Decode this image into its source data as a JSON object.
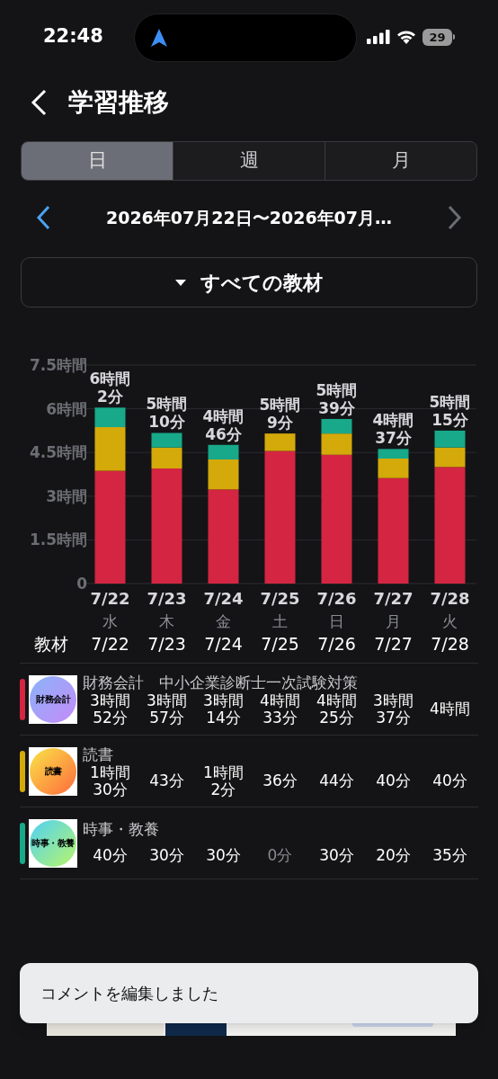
{
  "status_bar": {
    "time": "22:48",
    "battery": "29"
  },
  "header": {
    "title": "学習推移"
  },
  "tabs": [
    {
      "label": "日",
      "selected": true
    },
    {
      "label": "週",
      "selected": false
    },
    {
      "label": "月",
      "selected": false
    }
  ],
  "date_range": {
    "text": "2026年07月22日〜2026年07月…"
  },
  "filter": {
    "label": "すべての教材"
  },
  "chart": {
    "totals": [
      "6時間\n2分",
      "5時間\n10分",
      "4時間\n46分",
      "5時間\n9分",
      "5時間\n39分",
      "4時間\n37分",
      "5時間\n15分"
    ],
    "weekdays": [
      "水",
      "木",
      "金",
      "土",
      "日",
      "月",
      "火"
    ],
    "chart_data": {
      "type": "bar",
      "stacked": true,
      "categories": [
        "7/22",
        "7/23",
        "7/24",
        "7/25",
        "7/26",
        "7/27",
        "7/28"
      ],
      "series": [
        {
          "color": "#d42542",
          "values": [
            3.87,
            3.95,
            3.23,
            4.55,
            4.42,
            3.62,
            4.0
          ]
        },
        {
          "color": "#d4a90a",
          "values": [
            1.5,
            0.72,
            1.03,
            0.6,
            0.73,
            0.67,
            0.67
          ]
        },
        {
          "color": "#17a98a",
          "values": [
            0.67,
            0.5,
            0.5,
            0,
            0.5,
            0.33,
            0.58
          ]
        }
      ],
      "ylim": [
        0,
        7.5
      ],
      "grid": true,
      "yticks": [
        {
          "value": 0,
          "label": "0"
        },
        {
          "value": 1.5,
          "label": "1.5時間"
        },
        {
          "value": 3,
          "label": "3時間"
        },
        {
          "value": 4.5,
          "label": "4.5時間"
        },
        {
          "value": 6,
          "label": "6時間"
        },
        {
          "value": 7.5,
          "label": "7.5時間"
        }
      ]
    }
  },
  "table": {
    "header": "教材",
    "dates": [
      "7/22",
      "7/23",
      "7/24",
      "7/25",
      "7/26",
      "7/27",
      "7/28"
    ],
    "rows": [
      {
        "title": "財務会計　中小企業診断士一次試験対策",
        "icon_label": "財務会計",
        "color": "#d42542",
        "cells": [
          {
            "text": "3時間\n52分",
            "dim": false
          },
          {
            "text": "3時間\n57分",
            "dim": false
          },
          {
            "text": "3時間\n14分",
            "dim": false
          },
          {
            "text": "4時間\n33分",
            "dim": false
          },
          {
            "text": "4時間\n25分",
            "dim": false
          },
          {
            "text": "3時間\n37分",
            "dim": false
          },
          {
            "text": "4時間",
            "dim": false
          }
        ]
      },
      {
        "title": "読書",
        "icon_label": "読書",
        "color": "#d4a90a",
        "cells": [
          {
            "text": "1時間\n30分",
            "dim": false
          },
          {
            "text": "43分",
            "dim": false
          },
          {
            "text": "1時間\n2分",
            "dim": false
          },
          {
            "text": "36分",
            "dim": false
          },
          {
            "text": "44分",
            "dim": false
          },
          {
            "text": "40分",
            "dim": false
          },
          {
            "text": "40分",
            "dim": false
          }
        ]
      },
      {
        "title": "時事・教養",
        "icon_label": "時事・教養",
        "color": "#17a98a",
        "cells": [
          {
            "text": "40分",
            "dim": false
          },
          {
            "text": "30分",
            "dim": false
          },
          {
            "text": "30分",
            "dim": false
          },
          {
            "text": "0分",
            "dim": true
          },
          {
            "text": "30分",
            "dim": false
          },
          {
            "text": "20分",
            "dim": false
          },
          {
            "text": "35分",
            "dim": false
          }
        ]
      }
    ]
  },
  "toast": {
    "message": "コメントを編集しました"
  }
}
